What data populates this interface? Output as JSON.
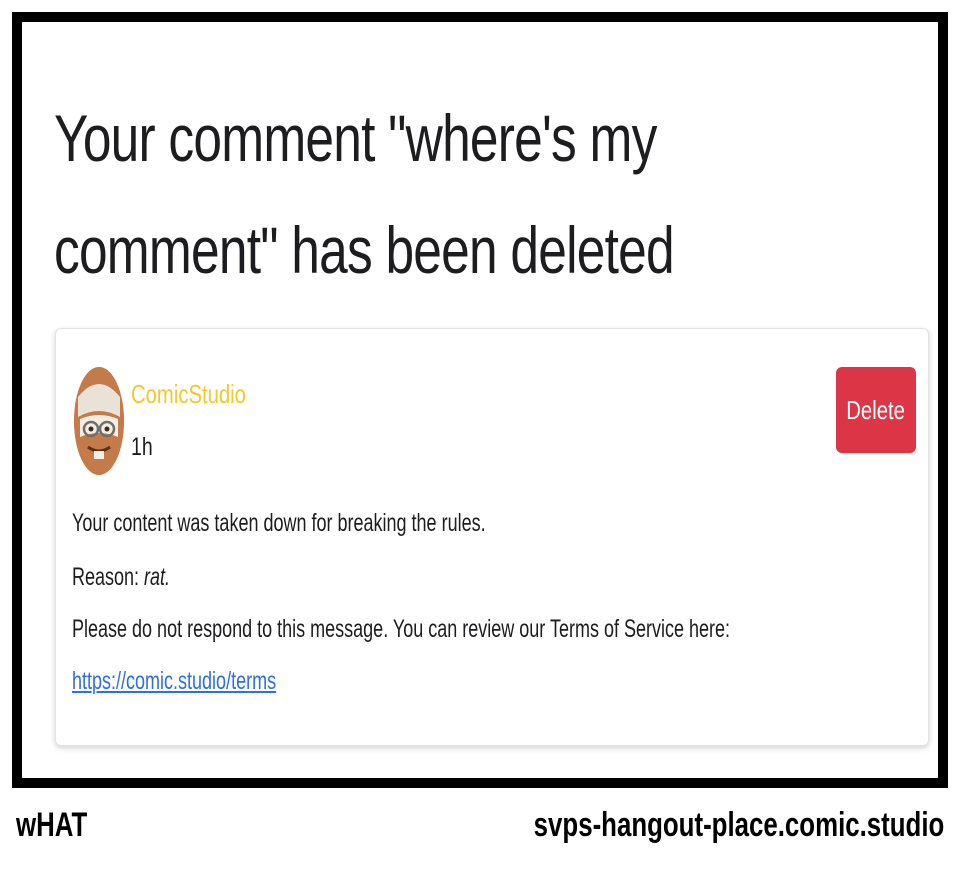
{
  "headline": "Your comment \"where's my comment\" has been deleted",
  "card": {
    "username": "ComicStudio",
    "timestamp": "1h",
    "delete_label": "Delete",
    "avatar_icon": "cookie-character-avatar-icon",
    "message_line1": "Your content was taken down for breaking the rules.",
    "reason_label": "Reason: ",
    "reason_value": "rat.",
    "message_line3": "Please do not respond to this message. You can review our Terms of Service here:",
    "terms_link": "https://comic.studio/terms"
  },
  "footer": {
    "left": "wHAT",
    "right": "svps-hangout-place.comic.studio"
  },
  "colors": {
    "username": "#f3c82c",
    "delete_button": "#dc3546",
    "link": "#2f6ee6",
    "panel_border": "#000000"
  }
}
